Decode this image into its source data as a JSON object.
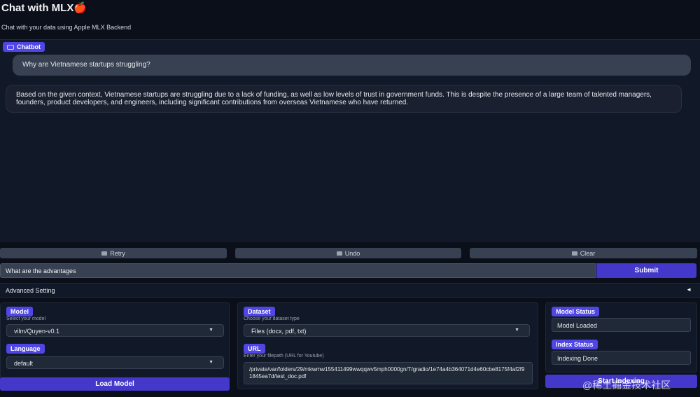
{
  "app": {
    "title": "Chat with MLX🍎",
    "subtitle": "Chat with your data using Apple MLX Backend"
  },
  "chatbot": {
    "label": "Chatbot",
    "messages": [
      {
        "role": "user",
        "text": "Why are Vietnamese startups struggling?"
      },
      {
        "role": "bot",
        "text": "Based on the given context, Vietnamese startups are struggling due to a lack of funding, as well as low levels of trust in government funds. This is despite the presence of a large team of talented managers, founders, product developers, and engineers, including significant contributions from overseas Vietnamese who have returned."
      }
    ]
  },
  "actions": {
    "retry_label": "Retry",
    "undo_label": "Undo",
    "clear_label": "Clear"
  },
  "input": {
    "value": "What are the advantages",
    "submit_label": "Submit"
  },
  "advanced": {
    "label": "Advanced Setting",
    "arrow": "◄"
  },
  "model_panel": {
    "model_label": "Model",
    "model_hint": "Select your model",
    "model_value": "vilm/Quyen-v0.1",
    "language_label": "Language",
    "language_value": "default",
    "load_label": "Load Model"
  },
  "dataset_panel": {
    "dataset_label": "Dataset",
    "dataset_hint": "Choose your dataset type",
    "dataset_value": "Files (docx, pdf, txt)",
    "url_label": "URL",
    "url_hint": "Enter your filepath (URL for Youtube)",
    "url_value": "/private/var/folders/29/mkwmw155411499wwqqwv5mph0000gn/T/gradio/1e74a4b364071d4e60cbe8175f4af2f91845ea7d/test_doc.pdf"
  },
  "status_panel": {
    "model_status_label": "Model Status",
    "model_status_value": "Model Loaded",
    "index_status_label": "Index Status",
    "index_status_value": "Indexing Done",
    "start_label": "Start Indexing"
  },
  "watermark": "@稀土掘金技术社区",
  "colors": {
    "background": "#0b0f19",
    "panel": "#111827",
    "accent": "#4338ca",
    "badge": "#4f46e5"
  }
}
